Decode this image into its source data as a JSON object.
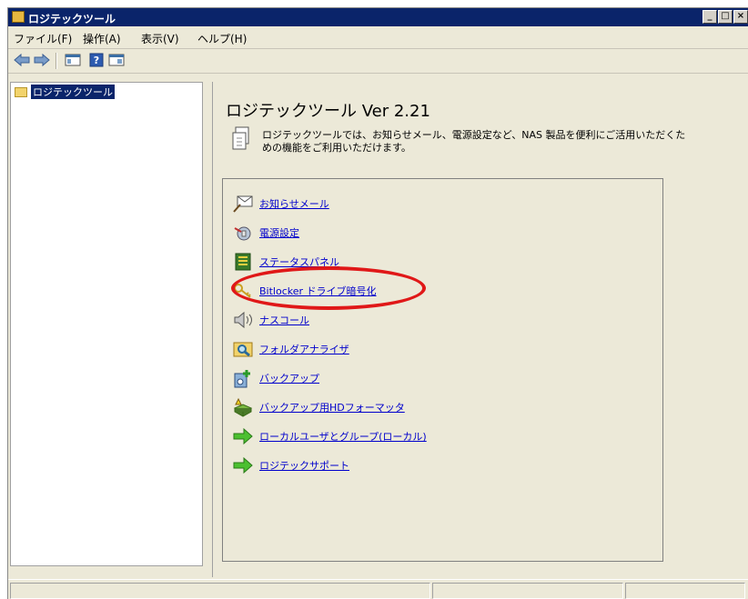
{
  "window": {
    "title": "ロジテックツール",
    "controls": [
      "_",
      "□",
      "×"
    ]
  },
  "menu": [
    "ファイル(F)",
    "操作(A)",
    "表示(V)",
    "ヘルプ(H)"
  ],
  "toolbar": [
    "back-arrow-icon",
    "forward-arrow-icon",
    "console-tree-icon",
    "help-icon",
    "show-hide-icon"
  ],
  "tree": {
    "root_label": "ロジテックツール"
  },
  "main": {
    "title": "ロジテックツール Ver 2.21",
    "intro": "ロジテックツールでは、お知らせメール、電源設定など、NAS 製品を便利にご活用いただくための機能をご利用いただけます。",
    "links": [
      {
        "label": "お知らせメール",
        "icon": "mail-icon"
      },
      {
        "label": "電源設定",
        "icon": "power-icon"
      },
      {
        "label": "ステータスパネル",
        "icon": "status-panel-icon"
      },
      {
        "label": "Bitlocker ドライブ暗号化",
        "icon": "bitlocker-key-icon"
      },
      {
        "label": "ナスコール",
        "icon": "speaker-icon"
      },
      {
        "label": "フォルダアナライザ",
        "icon": "folder-analyzer-icon"
      },
      {
        "label": "バックアップ",
        "icon": "backup-icon"
      },
      {
        "label": "バックアップ用HDフォーマッタ",
        "icon": "hd-formatter-icon"
      },
      {
        "label": "ローカルユーザとグループ(ローカル)",
        "icon": "green-arrow-icon"
      },
      {
        "label": "ロジテックサポート",
        "icon": "green-arrow-icon"
      }
    ]
  },
  "colors": {
    "title_bar": "#0a246a",
    "link": "#0000cc",
    "highlight": "#e01818",
    "window_bg": "#ece9d8"
  }
}
